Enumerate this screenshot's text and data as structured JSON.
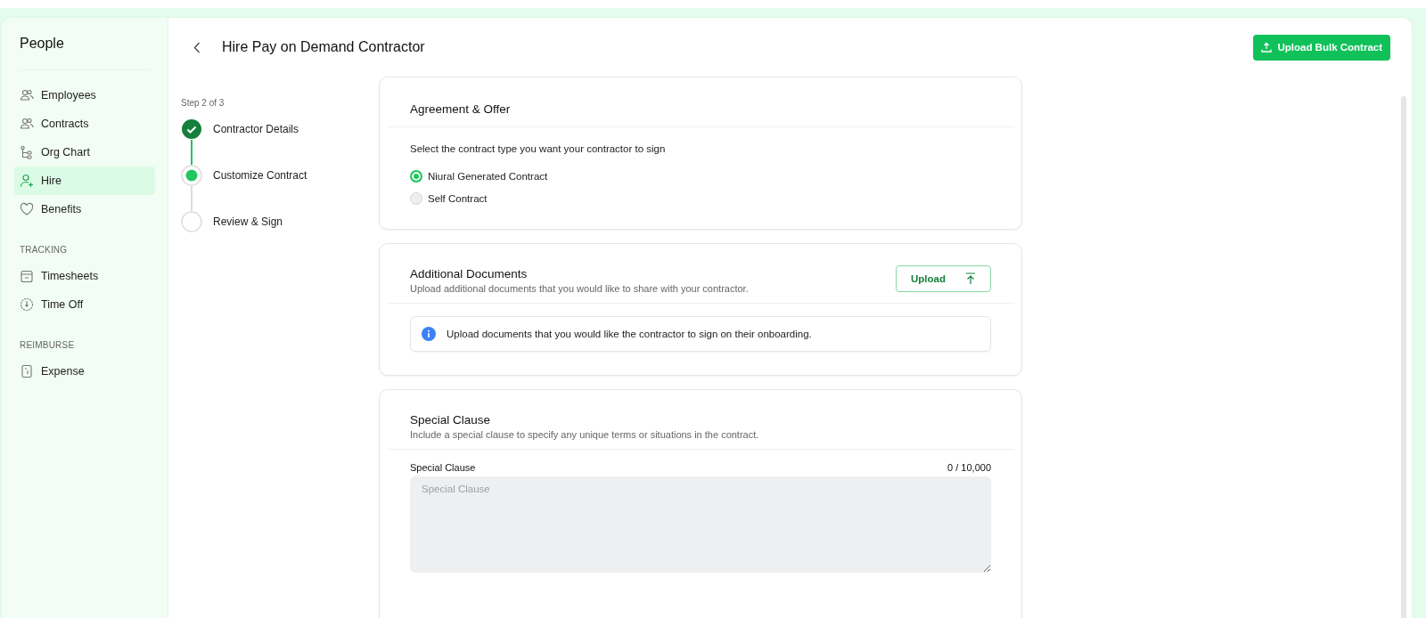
{
  "header": {
    "title": "Hire Pay on Demand Contractor",
    "bulk_button": "Upload Bulk Contract"
  },
  "sidebar": {
    "title": "People",
    "groups": [
      {
        "items": [
          {
            "label": "Employees",
            "kind": "people",
            "selected": false
          },
          {
            "label": "Contracts",
            "kind": "people",
            "selected": false
          },
          {
            "label": "Org Chart",
            "kind": "org",
            "selected": false
          },
          {
            "label": "Hire",
            "kind": "person-add",
            "selected": true
          },
          {
            "label": "Benefits",
            "kind": "heart",
            "selected": false
          }
        ]
      },
      {
        "heading": "TRACKING",
        "items": [
          {
            "label": "Timesheets",
            "kind": "calendar",
            "selected": false
          },
          {
            "label": "Time Off",
            "kind": "clock",
            "selected": false
          }
        ]
      },
      {
        "heading": "REIMBURSE",
        "items": [
          {
            "label": "Expense",
            "kind": "receipt",
            "selected": false
          }
        ]
      }
    ]
  },
  "stepper": {
    "caption": "Step 2 of 3",
    "steps": [
      {
        "label": "Contractor Details",
        "kind": "done"
      },
      {
        "label": "Customize Contract",
        "kind": "current"
      },
      {
        "label": "Review & Sign",
        "kind": "pending"
      }
    ]
  },
  "agreement": {
    "title": "Agreement & Offer",
    "prompt": "Select the contract type you want your contractor to sign",
    "options": [
      {
        "label": "Niural Generated Contract",
        "selected": true
      },
      {
        "label": "Self Contract",
        "selected": false
      }
    ]
  },
  "documents": {
    "title": "Additional Documents",
    "description": "Upload additional documents that you would like to share with your contractor.",
    "upload_button": "Upload",
    "notice": "Upload documents that you would like the contractor to sign on their onboarding."
  },
  "special_clause": {
    "title": "Special Clause",
    "description": "Include a special clause to specify any unique terms or situations in the contract.",
    "field": {
      "label": "Special Clause",
      "counter": "0 / 10,000",
      "placeholder": "Special Clause"
    }
  }
}
